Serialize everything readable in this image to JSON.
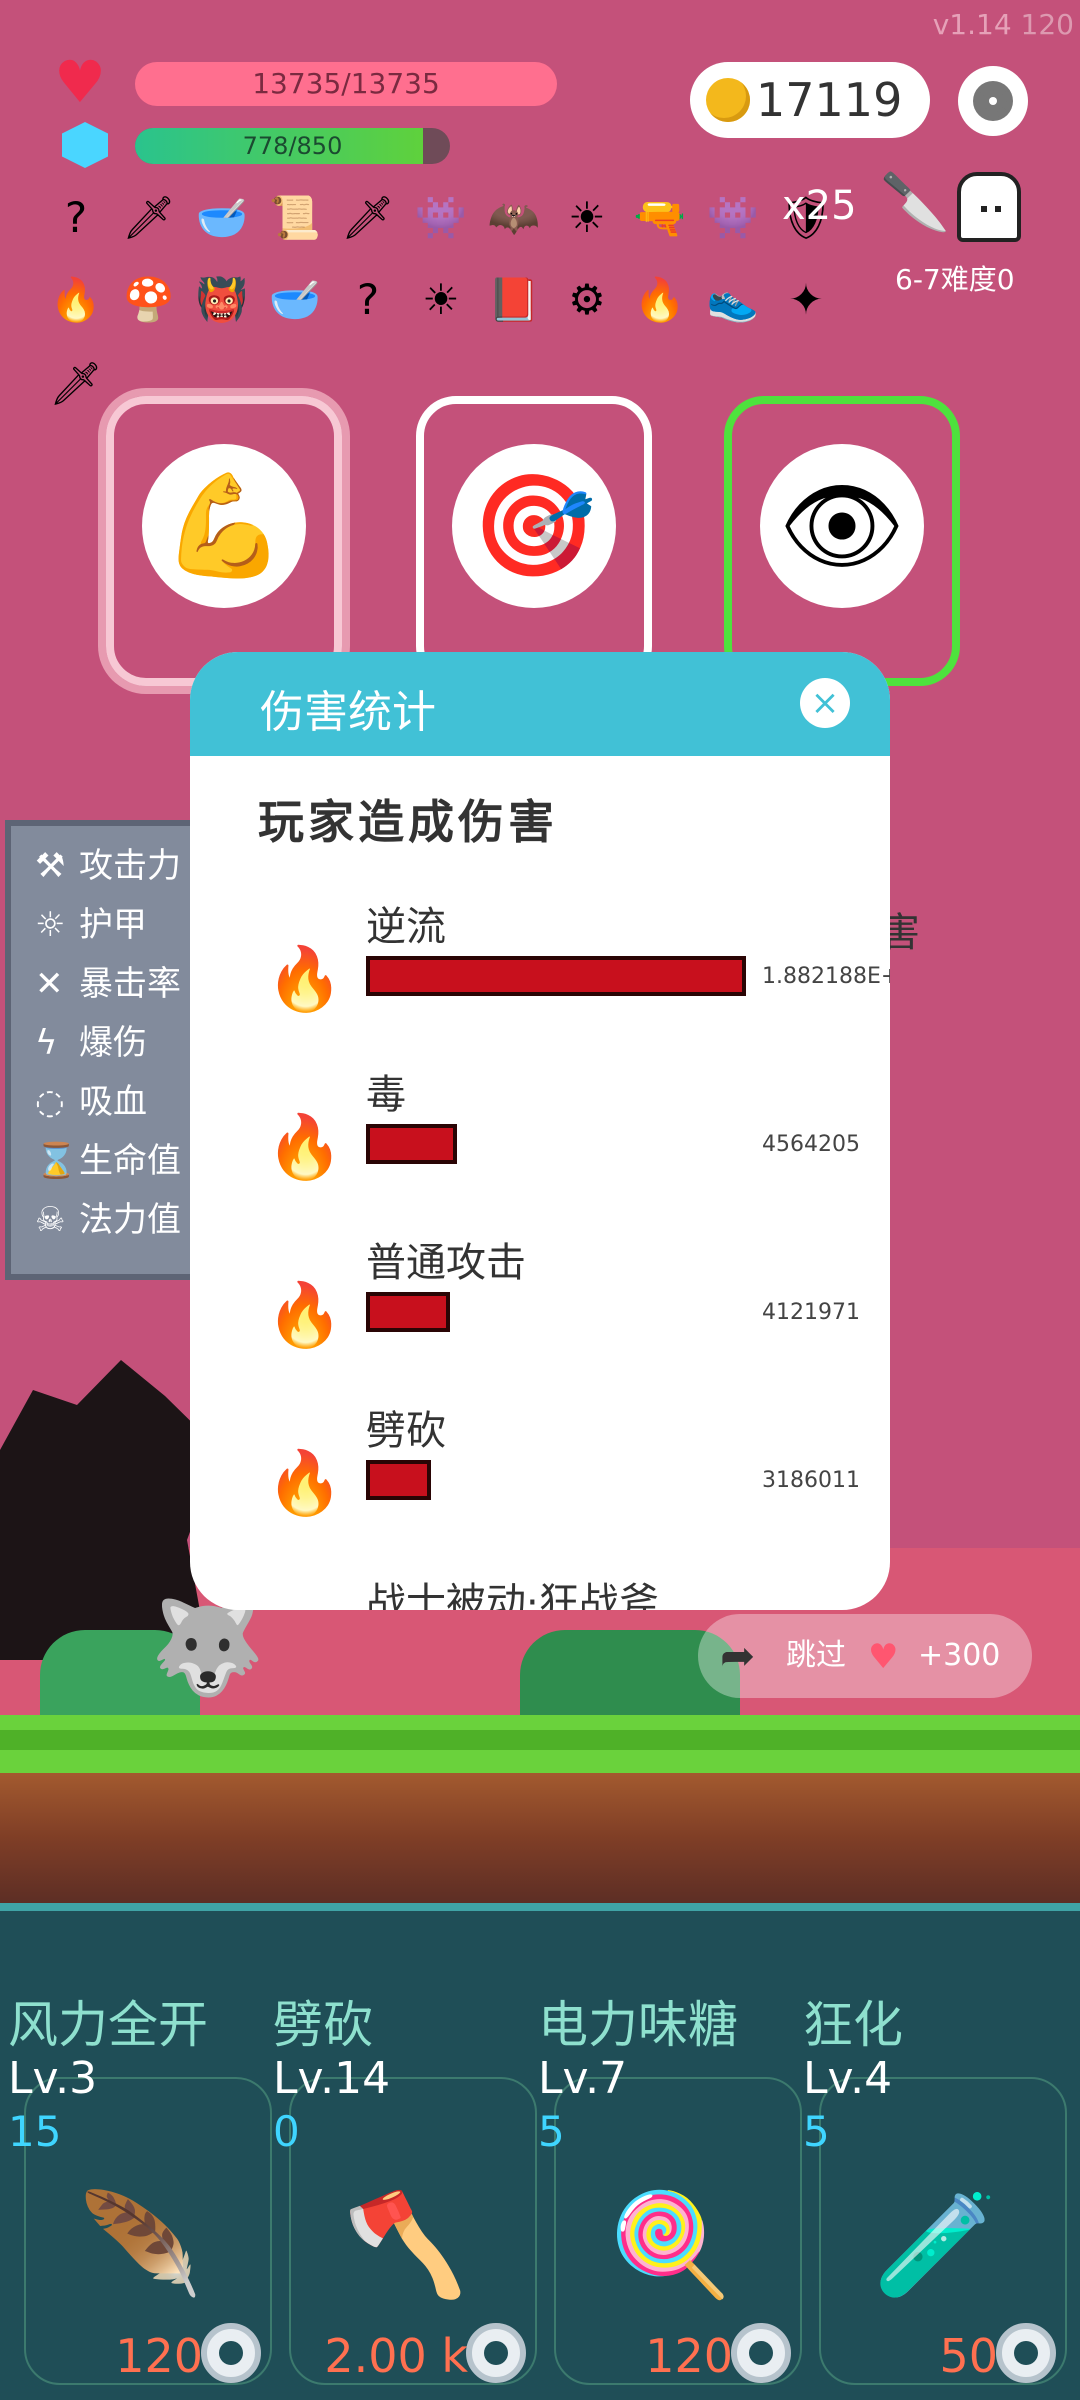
{
  "version": "v1.14",
  "fps": "120",
  "hp": "13735/13735",
  "mp": {
    "text": "778/850",
    "fraction": 0.915
  },
  "coins": "17119",
  "items_row1": [
    "?",
    "🗡",
    "🥣",
    "📜",
    "🗡",
    "👾",
    "🦇",
    "☀",
    "🔫",
    "👾",
    "🛡"
  ],
  "items_row2": [
    "🔥",
    "🍄",
    "👹",
    "🥣",
    "?",
    "☀",
    "📕",
    "⚙",
    "🔥",
    "👟",
    "✦"
  ],
  "items_row3": [
    "🗡"
  ],
  "stack": "x25",
  "difficulty": "6-7难度0",
  "buff_cards": [
    {
      "icon": "💪"
    },
    {
      "icon": "🎯"
    },
    {
      "icon": "👁"
    }
  ],
  "stats": [
    "攻击力",
    "护甲",
    "暴击率",
    "爆伤",
    "吸血",
    "生命值",
    "法力值"
  ],
  "stat_icons": [
    "⚒",
    "☼",
    "✕",
    "ϟ",
    "◌",
    "⌛",
    "☠"
  ],
  "bg_damage_text": "伤害",
  "skip": {
    "label": "跳过",
    "reward": "+300"
  },
  "modal": {
    "title": "伤害统计",
    "close": "×",
    "subtitle": "玩家造成伤害",
    "rows": [
      {
        "name": "逆流",
        "value": "1.882188E+",
        "fraction": 1.0
      },
      {
        "name": "毒",
        "value": "4564205",
        "fraction": 0.24
      },
      {
        "name": "普通攻击",
        "value": "4121971",
        "fraction": 0.22
      },
      {
        "name": "劈砍",
        "value": "3186011",
        "fraction": 0.17
      }
    ],
    "last_row": "战士被动·狂战斧"
  },
  "skills": [
    {
      "name": "风力全开",
      "level": "Lv.3",
      "count": "15",
      "cost": "120",
      "icon": "🪶"
    },
    {
      "name": "劈砍",
      "level": "Lv.14",
      "count": "0",
      "cost": "2.00 k",
      "icon": "🪓"
    },
    {
      "name": "电力味糖",
      "level": "Lv.7",
      "count": "5",
      "cost": "120",
      "icon": "🍭"
    },
    {
      "name": "狂化",
      "level": "Lv.4",
      "count": "5",
      "cost": "50",
      "icon": "🧪"
    }
  ]
}
